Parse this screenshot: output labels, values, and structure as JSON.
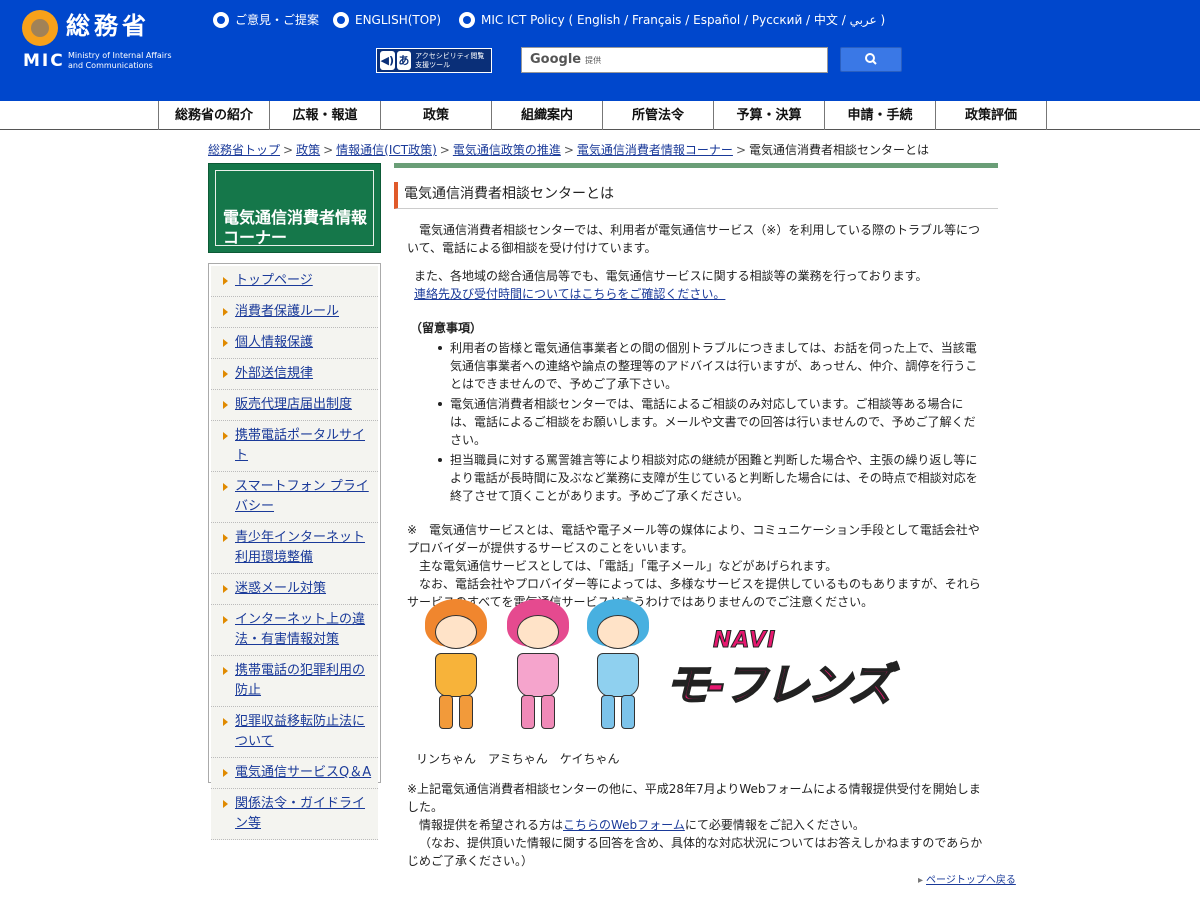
{
  "header": {
    "logo_ja": "総務省",
    "logo_mic": "MIC",
    "logo_en": "Ministry of Internal Affairs and Communications",
    "links": [
      "ご意見・ご提案",
      "ENGLISH(TOP)",
      "MIC ICT Policy ( English / Français / Español / Русский / 中文 / عربي )"
    ],
    "access_tool_label": "アクセシビリティ閲覧支援ツール",
    "access_tool_glyph": "あ",
    "search_brand": "Google",
    "search_sub": "提供",
    "search_button_icon": "search-icon"
  },
  "nav": {
    "items": [
      "総務省の紹介",
      "広報・報道",
      "政策",
      "組織案内",
      "所管法令",
      "予算・決算",
      "申請・手続",
      "政策評価"
    ]
  },
  "breadcrumb": {
    "items": [
      "総務省トップ",
      "政策",
      "情報通信(ICT政策)",
      "電気通信政策の推進",
      "電気通信消費者情報コーナー"
    ],
    "current": "電気通信消費者相談センターとは"
  },
  "sidebar": {
    "title": "電気通信消費者情報コーナー",
    "items": [
      "トップページ",
      "消費者保護ルール",
      "個人情報保護",
      "外部送信規律",
      "販売代理店届出制度",
      "携帯電話ポータルサイト",
      "スマートフォン プライバシー",
      "青少年インターネット利用環境整備",
      "迷惑メール対策",
      "インターネット上の違法・有害情報対策",
      "携帯電話の犯罪利用の防止",
      "犯罪収益移転防止法について",
      "電気通信サービスQ＆A",
      "関係法令・ガイドライン等"
    ]
  },
  "main": {
    "heading": "電気通信消費者相談センターとは",
    "intro": "電気通信消費者相談センターでは、利用者が電気通信サービス（※）を利用している際のトラブル等について、電話による御相談を受け付けています。",
    "regional": "また、各地域の総合通信局等でも、電気通信サービスに関する相談等の業務を行っております。",
    "regional_link": "連絡先及び受付時間についてはこちらをご確認ください。",
    "notes_title": "（留意事項）",
    "notes": [
      "利用者の皆様と電気通信事業者との間の個別トラブルにつきましては、お話を伺った上で、当該電気通信事業者への連絡や論点の整理等のアドバイスは行いますが、あっせん、仲介、調停を行うことはできませんので、予めご了承下さい。",
      "電気通信消費者相談センターでは、電話によるご相談のみ対応しています。ご相談等ある場合には、電話によるご相談をお願いします。メールや文書での回答は行いませんので、予めご了解ください。",
      "担当職員に対する罵詈雑言等により相談対応の継続が困難と判断した場合や、主張の繰り返し等により電話が長時間に及ぶなど業務に支障が生じていると判断した場合には、その時点で相談対応を終了させて頂くことがあります。予めご了承ください。"
    ],
    "footnote_1": "※　電気通信サービスとは、電話や電子メール等の媒体により、コミュニケーション手段として電話会社やプロバイダーが提供するサービスのことをいいます。",
    "footnote_2": "主な電気通信サービスとしては、「電話」「電子メール」などがあげられます。",
    "footnote_3": "なお、電話会社やプロバイダー等によっては、多様なサービスを提供しているものもありますが、それらサービスのすべてを電気通信サービスと言うわけではありませんのでご注意ください。",
    "characters_caption": "リンちゃん　アミちゃん　ケイちゃん",
    "logo_top": "NAVI",
    "logo_name": "モ-フレンズ",
    "web_note_1": "※上記電気通信消費者相談センターの他に、平成28年7月よりWebフォームによる情報提供受付を開始しました。",
    "web_note_2a": "情報提供を希望される方は",
    "web_note_2_link": "こちらのWebフォーム",
    "web_note_2b": "にて必要情報をご記入ください。",
    "web_note_3": "（なお、提供頂いた情報に関する回答を含め、具体的な対応状況についてはお答えしかねますのであらかじめご了承ください。）",
    "page_top": "ページトップへ戻る"
  },
  "colors": {
    "header_blue": "#0047cc",
    "sidebar_green": "#15774a",
    "logo_orange": "#f7a11a",
    "link_blue": "#1a3a99",
    "heading_accent": "#e05a2a",
    "logo_pink": "#e6186f"
  }
}
